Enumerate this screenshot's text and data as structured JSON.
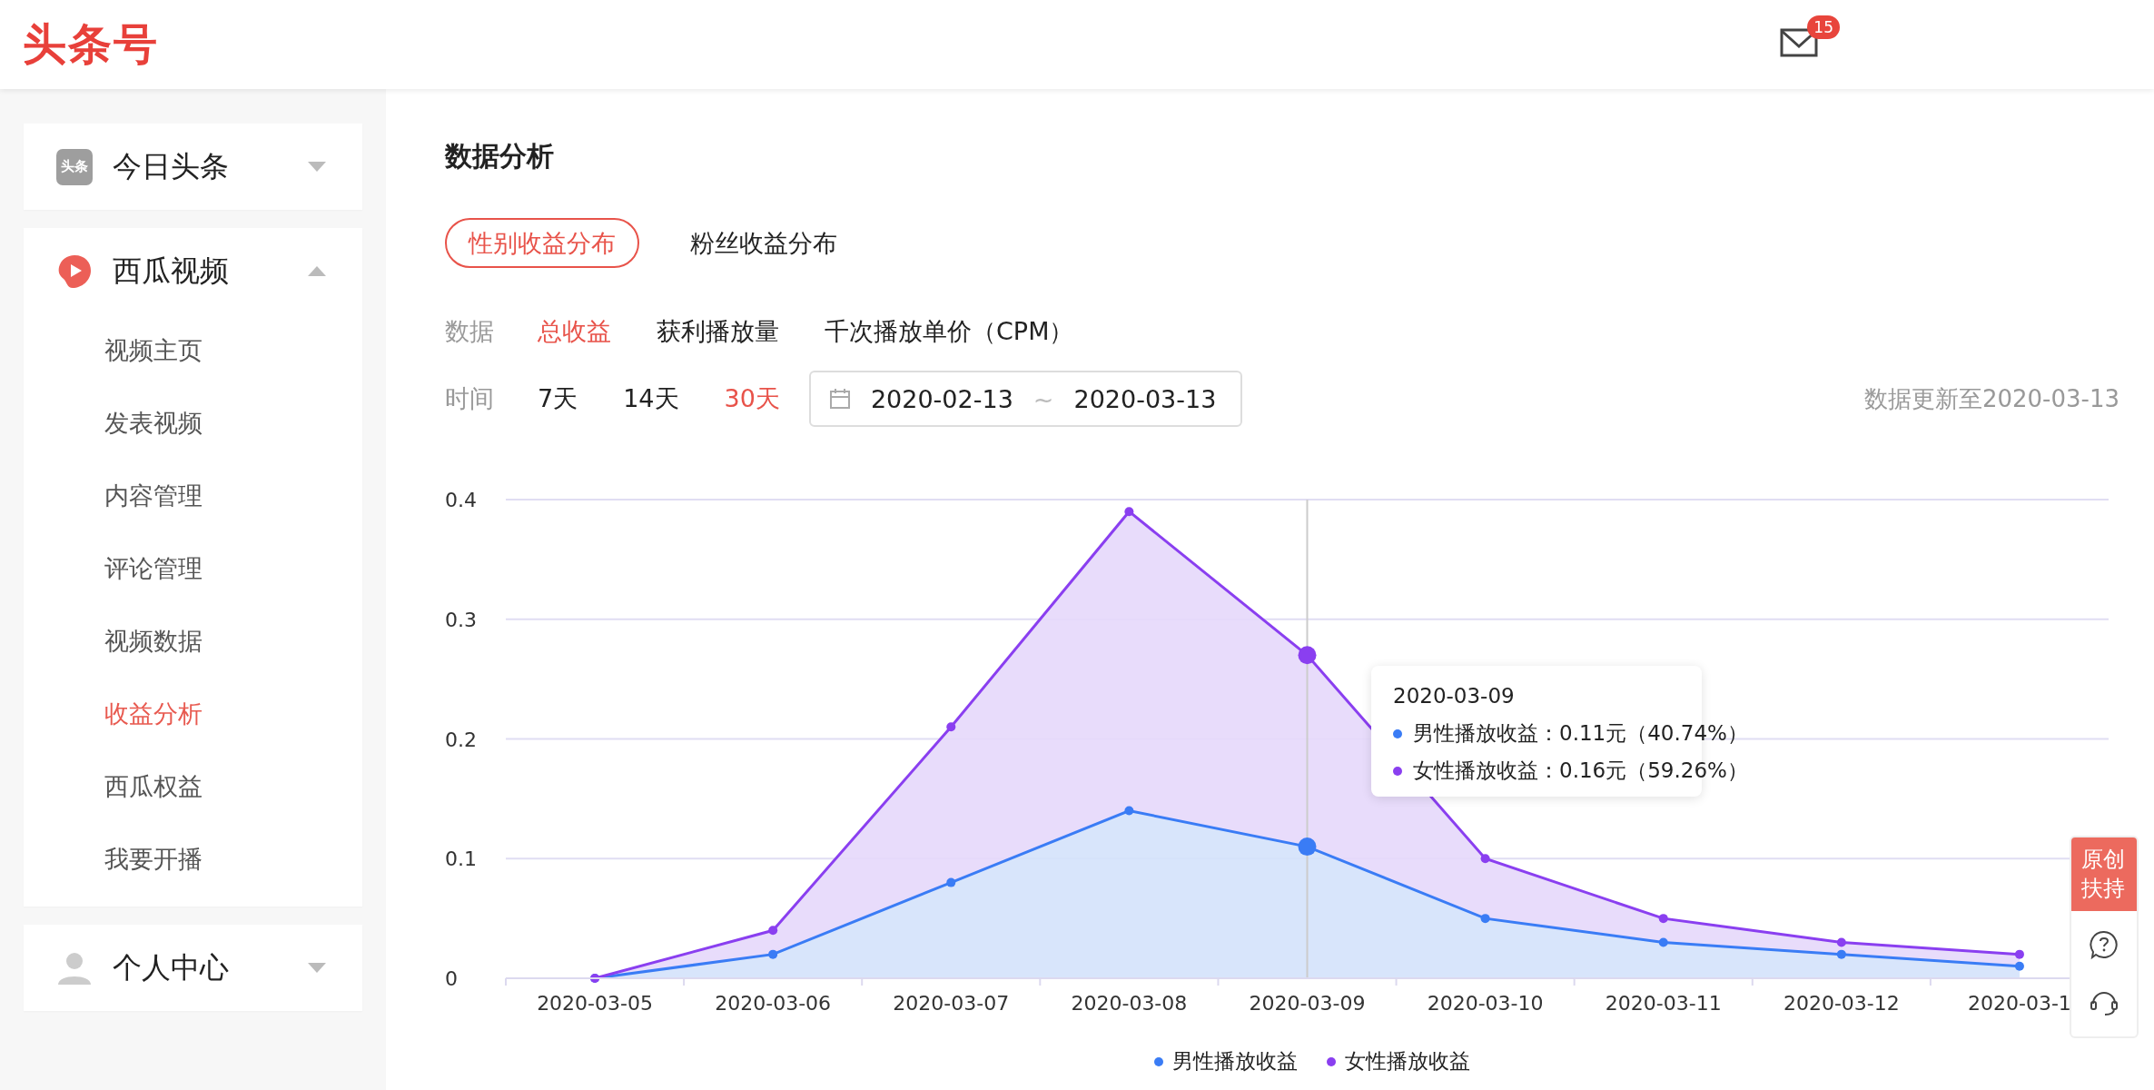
{
  "header": {
    "logo": "头条号",
    "mail_badge": "15"
  },
  "sidebar": {
    "groups": [
      {
        "title": "今日头条",
        "kind": "toutiao",
        "icon_text": "头条",
        "expanded": false
      },
      {
        "title": "西瓜视频",
        "kind": "xigua",
        "expanded": true,
        "children": [
          {
            "label": "视频主页",
            "selected": false
          },
          {
            "label": "发表视频",
            "selected": false
          },
          {
            "label": "内容管理",
            "selected": false
          },
          {
            "label": "评论管理",
            "selected": false
          },
          {
            "label": "视频数据",
            "selected": false
          },
          {
            "label": "收益分析",
            "selected": true
          },
          {
            "label": "西瓜权益",
            "selected": false
          },
          {
            "label": "我要开播",
            "selected": false
          }
        ]
      },
      {
        "title": "个人中心",
        "kind": "person",
        "expanded": false
      }
    ]
  },
  "main": {
    "title": "数据分析",
    "tabs": [
      {
        "label": "性别收益分布",
        "selected": true
      },
      {
        "label": "粉丝收益分布",
        "selected": false
      }
    ],
    "data_filter": {
      "label": "数据",
      "options": [
        {
          "label": "总收益",
          "selected": true
        },
        {
          "label": "获利播放量",
          "selected": false
        },
        {
          "label": "千次播放单价（CPM）",
          "selected": false
        }
      ]
    },
    "time_filter": {
      "label": "时间",
      "options": [
        {
          "label": "7天",
          "selected": false
        },
        {
          "label": "14天",
          "selected": false
        },
        {
          "label": "30天",
          "selected": true
        }
      ],
      "date_range": {
        "start": "2020-02-13",
        "separator": "~",
        "end": "2020-03-13"
      }
    },
    "update_note": "数据更新至2020-03-13",
    "chart_data": {
      "type": "area",
      "stacked": true,
      "categories": [
        "2020-03-05",
        "2020-03-06",
        "2020-03-07",
        "2020-03-08",
        "2020-03-09",
        "2020-03-10",
        "2020-03-11",
        "2020-03-12",
        "2020-03-1"
      ],
      "ylim": [
        0,
        0.4
      ],
      "yticks": [
        0,
        0.1,
        0.2,
        0.3,
        0.4
      ],
      "series": [
        {
          "name": "男性播放收益",
          "color": "#3a7cf5",
          "values": [
            0,
            0.02,
            0.08,
            0.14,
            0.11,
            0.05,
            0.03,
            0.02,
            0.01
          ]
        },
        {
          "name": "女性播放收益",
          "color": "#8a3ff0",
          "values": [
            0,
            0.02,
            0.13,
            0.25,
            0.16,
            0.05,
            0.02,
            0.01,
            0.01
          ]
        }
      ],
      "grid": true,
      "ref_lines": [
        {
          "axis": "x",
          "value": "2020-03-09"
        }
      ]
    },
    "tooltip": {
      "date": "2020-03-09",
      "rows": [
        {
          "text": "男性播放收益：0.11元（40.74%）",
          "color": "#3a7cf5"
        },
        {
          "text": "女性播放收益：0.16元（59.26%）",
          "color": "#8a3ff0"
        }
      ]
    }
  },
  "floating_panel": {
    "badge": "原创扶持"
  }
}
